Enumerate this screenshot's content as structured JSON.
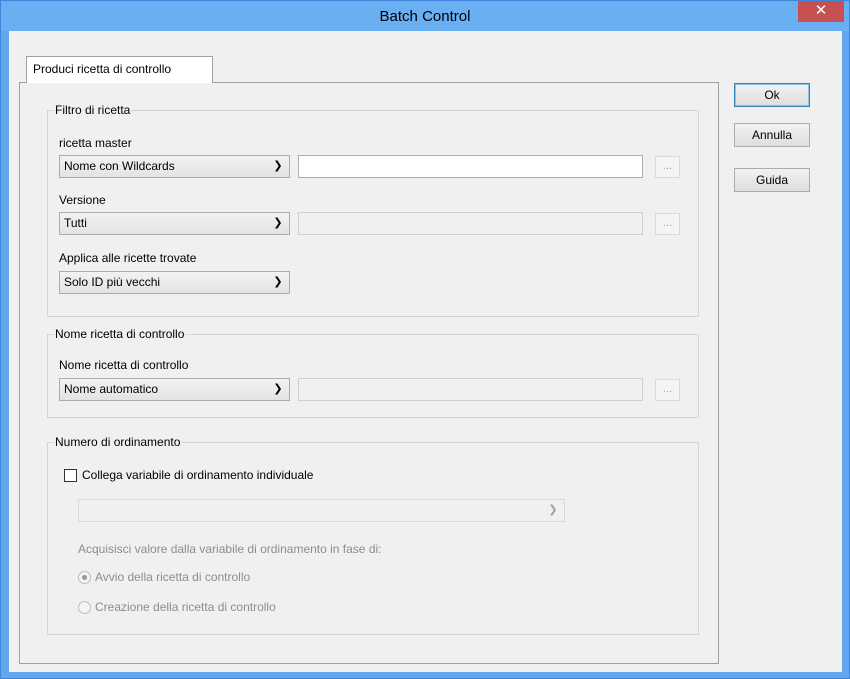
{
  "window": {
    "title": "Batch Control",
    "close_label": "✕"
  },
  "tabs": [
    {
      "label": "Produci ricetta di controllo"
    }
  ],
  "filter_group": {
    "title": "Filtro di ricetta",
    "master_label": "ricetta master",
    "master_select": "Nome con Wildcards",
    "master_text": "",
    "version_label": "Versione",
    "version_select": "Tutti",
    "version_text": "",
    "apply_label": "Applica alle ricette trovate",
    "apply_select": "Solo ID più vecchi",
    "browse_label": "..."
  },
  "control_name_group": {
    "title": "Nome ricetta di controllo",
    "name_label": "Nome ricetta di controllo",
    "name_select": "Nome automatico",
    "name_text": "",
    "browse_label": "..."
  },
  "order_group": {
    "title": "Numero di ordinamento",
    "checkbox_label": "Collega variabile di ordinamento individuale",
    "checkbox_checked": false,
    "variable_select": "",
    "acquire_label": "Acquisisci valore dalla variabile di ordinamento in fase di:",
    "radio_start": "Avvio della ricetta di controllo",
    "radio_create": "Creazione della ricetta di controllo",
    "selected_radio": "start"
  },
  "buttons": {
    "ok": "Ok",
    "cancel": "Annulla",
    "help": "Guida"
  },
  "icons": {
    "dropdown": "chevron-down-icon",
    "close": "close-icon"
  },
  "colors": {
    "title_bar": "#6aaff2",
    "close_button": "#c75050",
    "dialog_bg": "#f0f0f0"
  }
}
